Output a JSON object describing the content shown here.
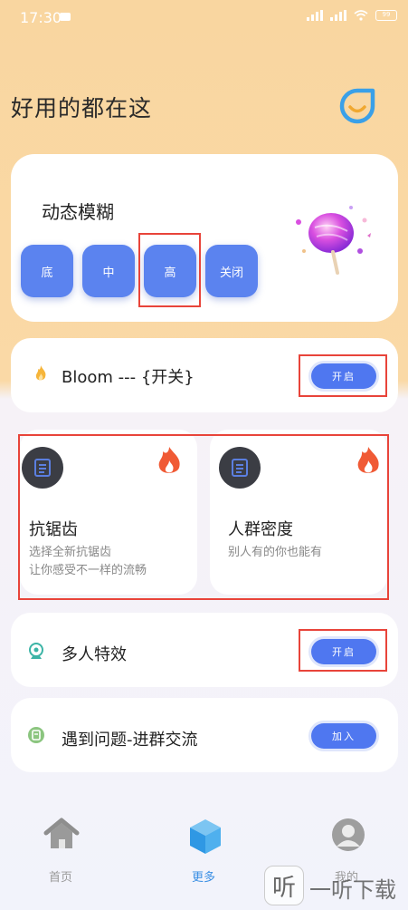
{
  "status": {
    "time": "17:30",
    "battery": "99"
  },
  "header": {
    "title": "好用的都在这"
  },
  "blur": {
    "title": "动态模糊",
    "levels": [
      "底",
      "中",
      "高",
      "关闭"
    ]
  },
  "bloom": {
    "label": "Bloom --- {开关}",
    "button": "开启"
  },
  "features": [
    {
      "title": "抗锯齿",
      "sub1": "选择全新抗锯齿",
      "sub2": "让你感受不一样的流畅"
    },
    {
      "title": "人群密度",
      "sub1": "别人有的你也能有",
      "sub2": ""
    }
  ],
  "multi": {
    "label": "多人特效",
    "button": "开启"
  },
  "group": {
    "label": "遇到问题-进群交流",
    "button": "加入"
  },
  "nav": {
    "home": "首页",
    "more": "更多",
    "mine": "我的"
  },
  "watermark": "一听下载",
  "colors": {
    "accent": "#5b83ef",
    "highlight": "#e8443a",
    "fire": "#f05a35"
  }
}
